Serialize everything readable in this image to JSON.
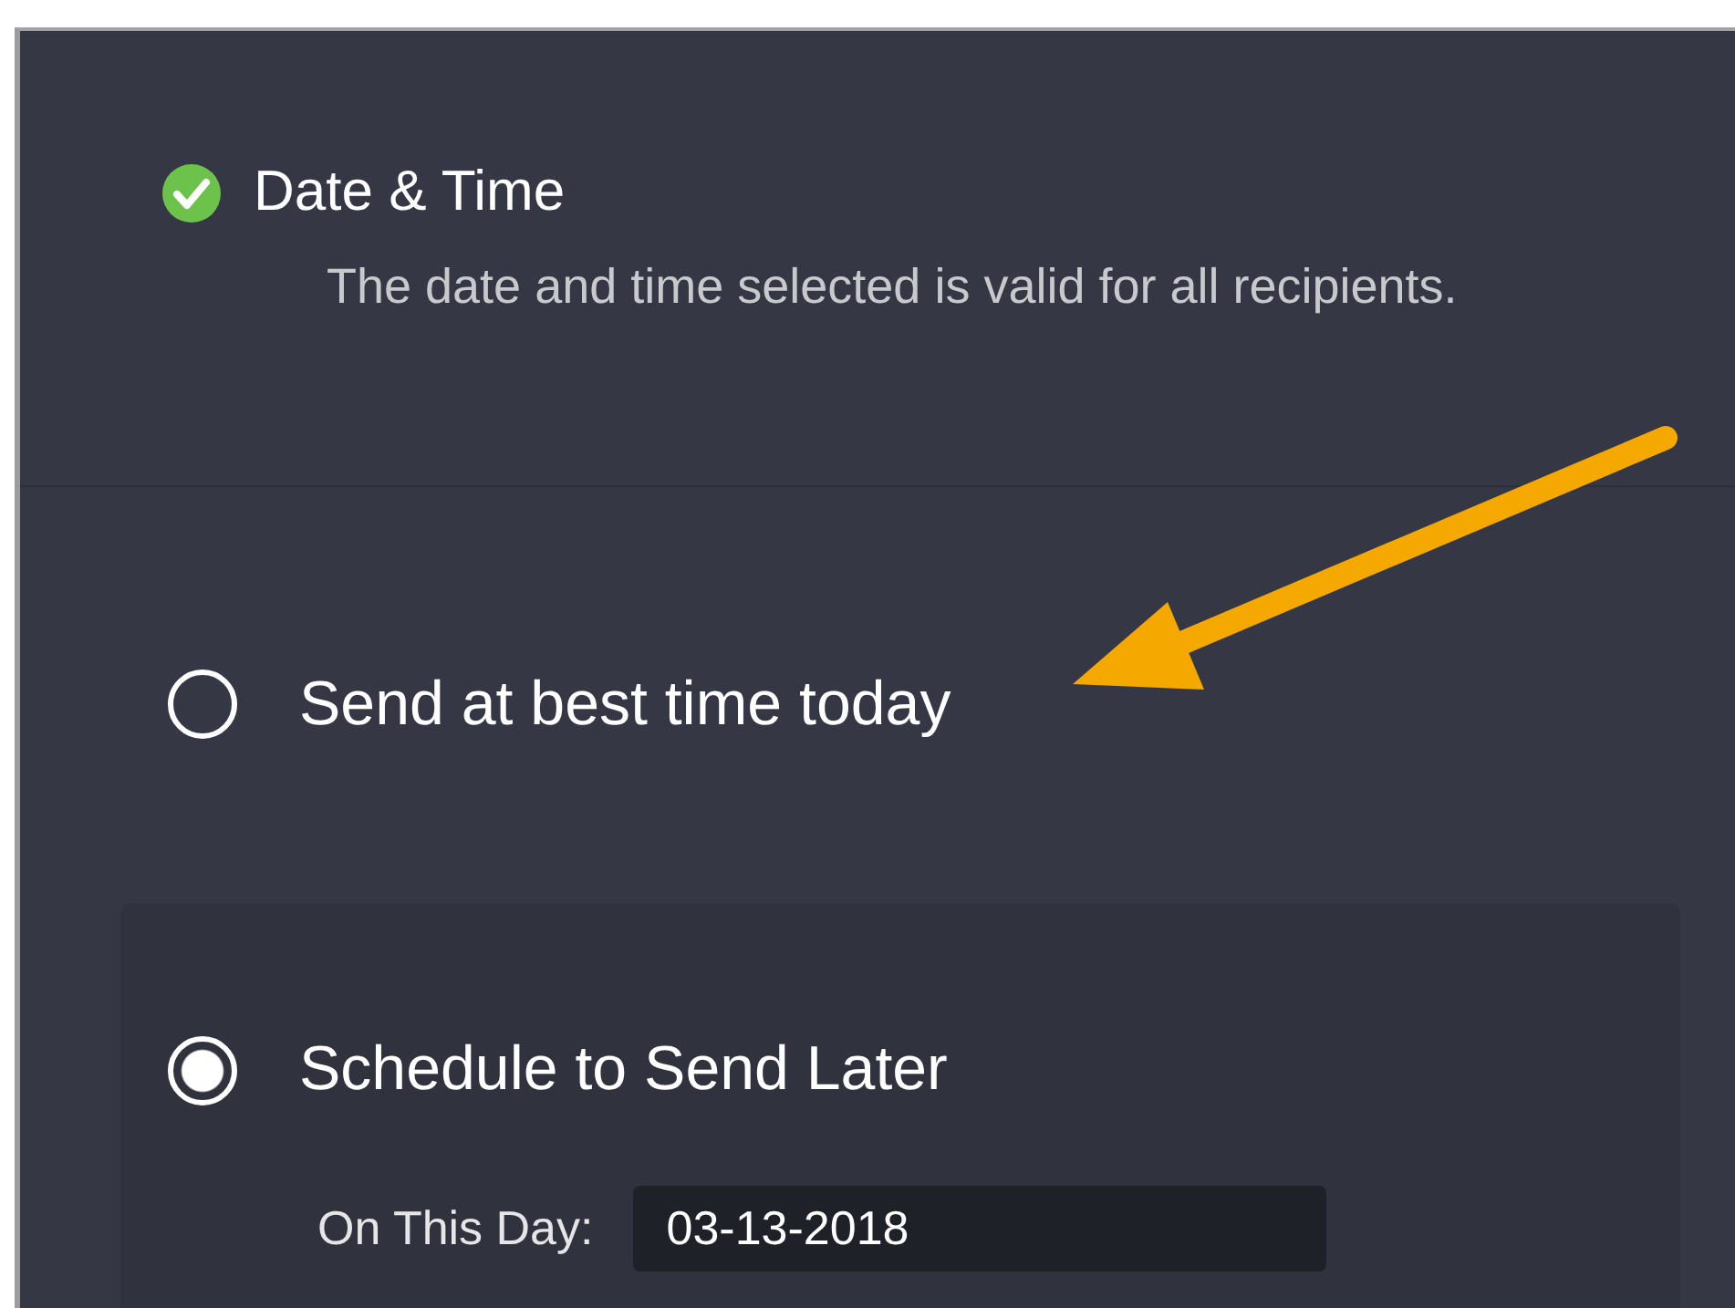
{
  "header": {
    "title": "Date & Time",
    "message": "The date and time selected is valid for all recipients."
  },
  "options": [
    {
      "label": "Send at best time today",
      "selected": false
    },
    {
      "label": "Schedule to Send Later",
      "selected": true
    }
  ],
  "schedule": {
    "label": "On This Day:",
    "value": "03-13-2018"
  }
}
